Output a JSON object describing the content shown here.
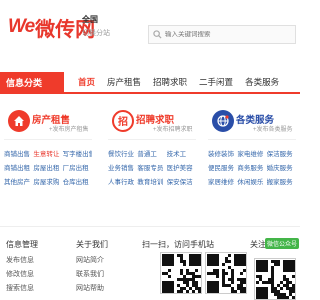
{
  "header": {
    "logo_we": "We",
    "logo_cn": "微传网",
    "city_name": "全国",
    "city_switch": "切换分站",
    "search_placeholder": "输入关键词搜索"
  },
  "nav": {
    "category_label": "信息分类",
    "items": [
      "首页",
      "房产租售",
      "招聘求职",
      "二手闲置",
      "各类服务"
    ]
  },
  "categories": [
    {
      "title": "房产租售",
      "post_link": "+发布房产租售",
      "icon": "house-icon",
      "color": "#ef3b2b",
      "links": [
        {
          "text": "商铺出售",
          "hot": false
        },
        {
          "text": "生意转让",
          "hot": true
        },
        {
          "text": "写字楼出售",
          "hot": false
        },
        {
          "text": "商铺出租",
          "hot": false
        },
        {
          "text": "房屋出租",
          "hot": false
        },
        {
          "text": "厂房出租",
          "hot": false
        },
        {
          "text": "其他房产",
          "hot": false
        },
        {
          "text": "房屋求购",
          "hot": false
        },
        {
          "text": "仓库出租",
          "hot": false
        }
      ]
    },
    {
      "title": "招聘求职",
      "post_link": "+发布招聘求职",
      "icon": "recruit-icon",
      "color": "#ef3b2b",
      "links": [
        {
          "text": "餐饮行业",
          "hot": false
        },
        {
          "text": "普通工",
          "hot": false
        },
        {
          "text": "技术工",
          "hot": false
        },
        {
          "text": "业务销售",
          "hot": false
        },
        {
          "text": "客服专员",
          "hot": false
        },
        {
          "text": "医护美容",
          "hot": false
        },
        {
          "text": "人事行政",
          "hot": false
        },
        {
          "text": "教育培训",
          "hot": false
        },
        {
          "text": "保安保洁",
          "hot": false
        }
      ]
    },
    {
      "title": "各类服务",
      "post_link": "+发布各类服务",
      "icon": "globe-icon",
      "color": "#2a4ea8",
      "links": [
        {
          "text": "装修装饰",
          "hot": false
        },
        {
          "text": "家电维修",
          "hot": false
        },
        {
          "text": "保洁服务",
          "hot": false
        },
        {
          "text": "便民服务",
          "hot": false
        },
        {
          "text": "商务服务",
          "hot": false
        },
        {
          "text": "婚庆服务",
          "hot": false
        },
        {
          "text": "家居维修",
          "hot": false
        },
        {
          "text": "休闲娱乐",
          "hot": false
        },
        {
          "text": "搬家服务",
          "hot": false
        }
      ]
    }
  ],
  "footer": {
    "info_title": "信息管理",
    "info_items": [
      "发布信息",
      "修改信息",
      "搜索信息"
    ],
    "about_title": "关于我们",
    "about_items": [
      "网站简介",
      "联系我们",
      "网站帮助"
    ],
    "scan_title": "扫一扫，访问手机站",
    "follow_title": "关注我",
    "wechat_label": "微信公众号"
  }
}
